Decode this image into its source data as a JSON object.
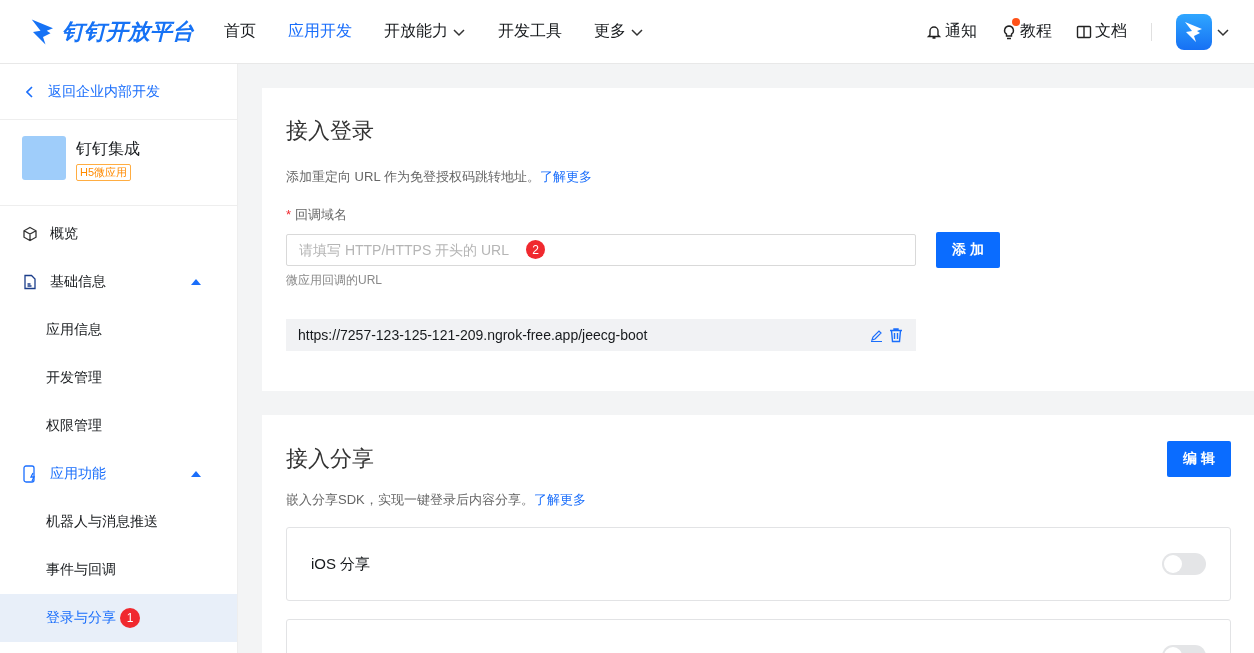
{
  "header": {
    "logo": "钉钉开放平台",
    "nav": [
      {
        "label": "首页",
        "selected": false,
        "dropdown": false
      },
      {
        "label": "应用开发",
        "selected": true,
        "dropdown": false
      },
      {
        "label": "开放能力",
        "selected": false,
        "dropdown": true
      },
      {
        "label": "开发工具",
        "selected": false,
        "dropdown": false
      },
      {
        "label": "更多",
        "selected": false,
        "dropdown": true
      }
    ],
    "links": [
      {
        "label": "通知",
        "kind": "bell",
        "dot": false
      },
      {
        "label": "教程",
        "kind": "bulb",
        "dot": true
      },
      {
        "label": "文档",
        "kind": "book",
        "dot": false
      }
    ]
  },
  "sidebar": {
    "back": "返回企业内部开发",
    "app": {
      "name": "钉钉集成",
      "tag": "H5微应用"
    },
    "items": [
      {
        "label": "概览",
        "kind": "cube"
      },
      {
        "label": "基础信息",
        "kind": "doc",
        "expanded": true,
        "children": [
          {
            "label": "应用信息",
            "selected": false
          },
          {
            "label": "开发管理",
            "selected": false
          },
          {
            "label": "权限管理",
            "selected": false
          }
        ]
      },
      {
        "label": "应用功能",
        "kind": "phone",
        "expanded": true,
        "children": [
          {
            "label": "机器人与消息推送",
            "selected": false
          },
          {
            "label": "事件与回调",
            "selected": false
          },
          {
            "label": "登录与分享",
            "selected": true,
            "badge": "1"
          }
        ]
      }
    ]
  },
  "login": {
    "title": "接入登录",
    "desc": "添加重定向 URL 作为免登授权码跳转地址。",
    "link": "了解更多",
    "field_label": "回调域名",
    "required_mark": "*",
    "placeholder": "请填写 HTTP/HTTPS 开头的 URL",
    "badge": "2",
    "hint": "微应用回调的URL",
    "button": "添 加",
    "urls": [
      "https://7257-123-125-121-209.ngrok-free.app/jeecg-boot"
    ]
  },
  "share": {
    "title": "接入分享",
    "button": "编 辑",
    "desc": "嵌入分享SDK，实现一键登录后内容分享。",
    "link": "了解更多",
    "options": [
      {
        "label": "iOS 分享",
        "on": false
      },
      {
        "on": false
      }
    ]
  }
}
